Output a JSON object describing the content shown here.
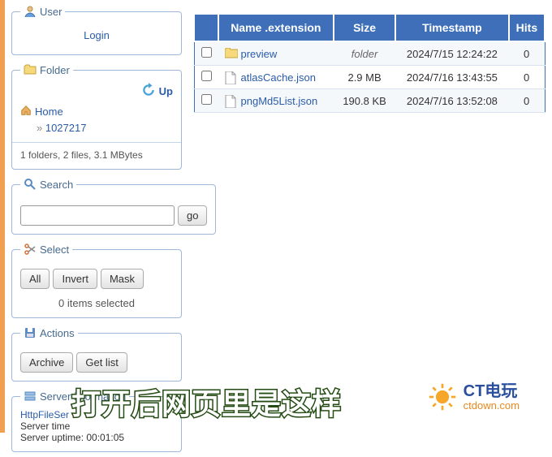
{
  "user": {
    "legend": "User",
    "login": "Login"
  },
  "folder": {
    "legend": "Folder",
    "up": "Up",
    "home": "Home",
    "crumb": "1027217",
    "stats": "1 folders, 2 files, 3.1 MBytes"
  },
  "search": {
    "legend": "Search",
    "go": "go",
    "value": ""
  },
  "select": {
    "legend": "Select",
    "all": "All",
    "invert": "Invert",
    "mask": "Mask",
    "status": "0 items selected"
  },
  "actions": {
    "legend": "Actions",
    "archive": "Archive",
    "getlist": "Get list"
  },
  "server": {
    "legend": "Server information",
    "link": "HttpFileSer",
    "time": "Server time",
    "uptime": "Server uptime: 00:01:05"
  },
  "table": {
    "headers": {
      "name": "Name .extension",
      "size": "Size",
      "ts": "Timestamp",
      "hits": "Hits"
    },
    "rows": [
      {
        "name": "preview",
        "type": "folder",
        "size": "folder",
        "ts": "2024/7/15 12:24:22",
        "hits": "0"
      },
      {
        "name": "atlasCache.json",
        "type": "file",
        "size": "2.9 MB",
        "ts": "2024/7/16 13:43:55",
        "hits": "0"
      },
      {
        "name": "pngMd5List.json",
        "type": "file",
        "size": "190.8 KB",
        "ts": "2024/7/16 13:52:08",
        "hits": "0"
      }
    ]
  },
  "overlay": {
    "subtitle": "打开后网页里是这样",
    "wm_title": "CT电玩",
    "wm_sub": "ctdown.com"
  }
}
